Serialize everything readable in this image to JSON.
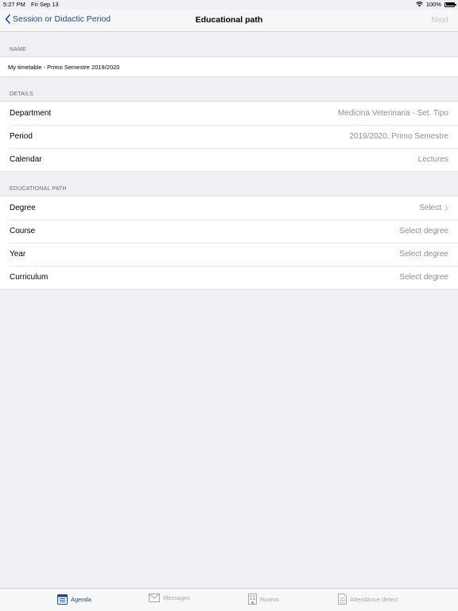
{
  "status_bar": {
    "time": "5:27 PM",
    "date": "Fri Sep 13",
    "battery": "100%"
  },
  "nav": {
    "back_label": "Session or Didactic Period",
    "title": "Educational path",
    "next_label": "Next"
  },
  "name_section": {
    "header": "NAME",
    "value": "My timetable - Primo Semestre 2019/2020"
  },
  "details_section": {
    "header": "DETAILS",
    "rows": [
      {
        "label": "Department",
        "value": "Medicina Veterinaria - Set. Tipo"
      },
      {
        "label": "Period",
        "value": "2019/2020, Primo Semestre"
      },
      {
        "label": "Calendar",
        "value": "Lectures"
      }
    ]
  },
  "path_section": {
    "header": "EDUCATIONAL PATH",
    "rows": [
      {
        "label": "Degree",
        "value": "Select"
      },
      {
        "label": "Course",
        "value": "Select degree"
      },
      {
        "label": "Year",
        "value": "Select degree"
      },
      {
        "label": "Curriculum",
        "value": "Select degree"
      }
    ]
  },
  "tabs": [
    {
      "label": "Agenda",
      "icon": "calendar-icon"
    },
    {
      "label": "Messages",
      "icon": "envelope-icon"
    },
    {
      "label": "Rooms",
      "icon": "building-icon"
    },
    {
      "label": "Attendance detect",
      "icon": "document-icon"
    }
  ],
  "colors": {
    "accent": "#1c4b8c",
    "background": "#efeff4",
    "muted": "#8e8e93"
  }
}
